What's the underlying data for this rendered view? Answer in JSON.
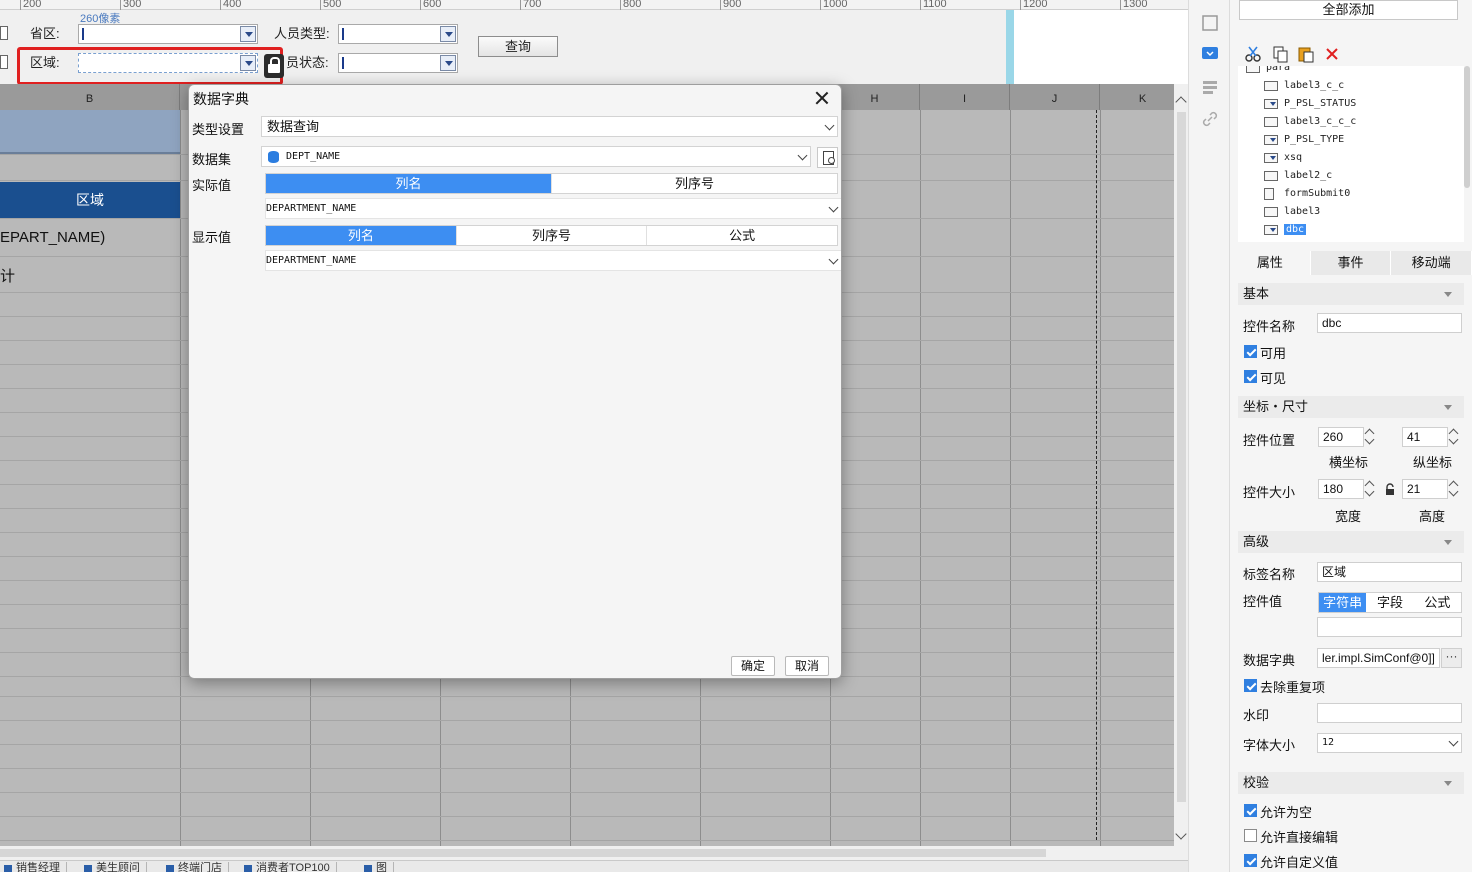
{
  "ruler": {
    "ticks": [
      "200",
      "300",
      "400",
      "500",
      "600",
      "700",
      "800",
      "900",
      "1000",
      "1100",
      "1200",
      "1300"
    ]
  },
  "param": {
    "width_tip": "260像素",
    "province_label": "省区:",
    "area_label": "区域:",
    "person_type_label": "人员类型:",
    "person_status_label": "员状态:",
    "query_button": "查询"
  },
  "grid": {
    "columns": [
      "B",
      "H",
      "I",
      "J",
      "K"
    ],
    "area_header": "区域",
    "depart_cell": "EPART_NAME)",
    "ji_cell": "计"
  },
  "sheet_tabs": [
    "销售经理",
    "美生顾问",
    "终端门店",
    "消费者TOP100",
    "图"
  ],
  "dialog": {
    "title": "数据字典",
    "type_label": "类型设置",
    "type_value": "数据查询",
    "dataset_label": "数据集",
    "dataset_value": "DEPT_NAME",
    "actual_label": "实际值",
    "actual_tabs": [
      "列名",
      "列序号"
    ],
    "actual_value": "DEPARTMENT_NAME",
    "display_label": "显示值",
    "display_tabs": [
      "列名",
      "列序号",
      "公式"
    ],
    "display_value": "DEPARTMENT_NAME",
    "ok_button": "确定",
    "cancel_button": "取消"
  },
  "right_panel": {
    "add_all": "全部添加",
    "tree_partial": "para",
    "tree_items": [
      "label3_c_c",
      "P_PSL_STATUS",
      "label3_c_c_c",
      "P_PSL_TYPE",
      "xsq",
      "label2_c",
      "formSubmit0",
      "label3",
      "dbc"
    ],
    "tabs": [
      "属性",
      "事件",
      "移动端"
    ],
    "basic": {
      "section": "基本",
      "name_label": "控件名称",
      "name_value": "dbc",
      "enabled": "可用",
      "visible": "可见"
    },
    "geometry": {
      "section": "坐标・尺寸",
      "pos_label": "控件位置",
      "x_value": "260",
      "y_value": "41",
      "x_caption": "横坐标",
      "y_caption": "纵坐标",
      "size_label": "控件大小",
      "w_value": "180",
      "h_value": "21",
      "w_caption": "宽度",
      "h_caption": "高度"
    },
    "advanced": {
      "section": "高级",
      "tag_label": "标签名称",
      "tag_value": "区域",
      "value_label": "控件值",
      "value_tabs": [
        "字符串",
        "字段",
        "公式"
      ],
      "dict_label": "数据字典",
      "dict_value": "ler.impl.SimConf@0]]",
      "dict_more": "···",
      "dedupe": "去除重复项",
      "watermark_label": "水印",
      "font_label": "字体大小",
      "font_value": "12"
    },
    "validate": {
      "section": "校验",
      "allow_empty": "允许为空",
      "allow_direct_edit": "允许直接编辑",
      "allow_custom": "允许自定义值"
    }
  },
  "colors": {
    "accent": "#3d8ef2",
    "header_blue": "#1a4f8f",
    "highlight_red": "#e02020"
  }
}
